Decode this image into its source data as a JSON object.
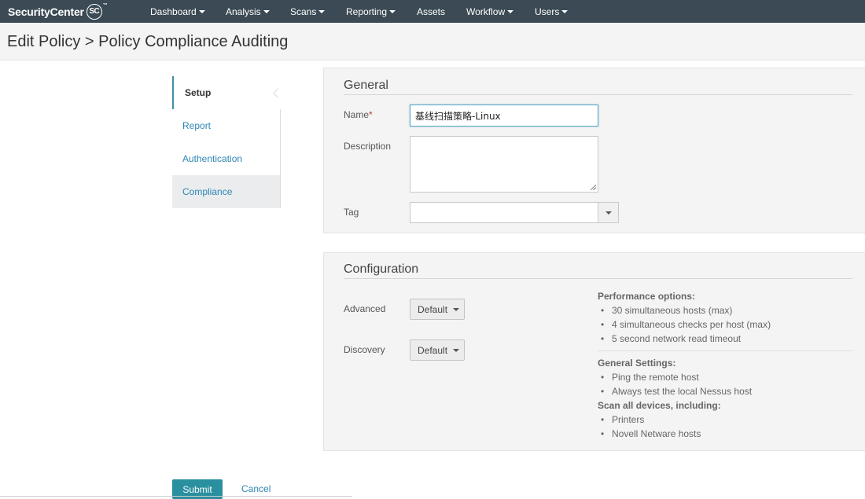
{
  "app": {
    "logo_text": "SecurityCenter",
    "logo_badge": "SC",
    "logo_tm": "™"
  },
  "nav": {
    "items": [
      {
        "label": "Dashboard",
        "dropdown": true
      },
      {
        "label": "Analysis",
        "dropdown": true
      },
      {
        "label": "Scans",
        "dropdown": true
      },
      {
        "label": "Reporting",
        "dropdown": true
      },
      {
        "label": "Assets",
        "dropdown": false
      },
      {
        "label": "Workflow",
        "dropdown": true
      },
      {
        "label": "Users",
        "dropdown": true
      }
    ]
  },
  "page": {
    "title": "Edit Policy > Policy Compliance Auditing"
  },
  "tabs": [
    {
      "label": "Setup",
      "active": true
    },
    {
      "label": "Report",
      "active": false
    },
    {
      "label": "Authentication",
      "active": false
    },
    {
      "label": "Compliance",
      "active": false
    }
  ],
  "general": {
    "title": "General",
    "name_label": "Name",
    "required_mark": "*",
    "name_value": "基线扫描策略-Linux",
    "description_label": "Description",
    "description_value": "",
    "tag_label": "Tag",
    "tag_value": ""
  },
  "configuration": {
    "title": "Configuration",
    "advanced_label": "Advanced",
    "advanced_value": "Default",
    "discovery_label": "Discovery",
    "discovery_value": "Default",
    "performance_heading": "Performance options:",
    "performance_items": [
      "30 simultaneous hosts (max)",
      "4 simultaneous checks per host (max)",
      "5 second network read timeout"
    ],
    "general_settings_heading": "General Settings:",
    "general_settings_items": [
      "Ping the remote host",
      "Always test the local Nessus host"
    ],
    "scan_devices_heading": "Scan all devices, including:",
    "scan_devices_items": [
      "Printers",
      "Novell Netware hosts"
    ]
  },
  "actions": {
    "submit_label": "Submit",
    "cancel_label": "Cancel"
  },
  "colors": {
    "topbar": "#3b4a54",
    "accent": "#2a8f9e",
    "link": "#2e86b5"
  }
}
